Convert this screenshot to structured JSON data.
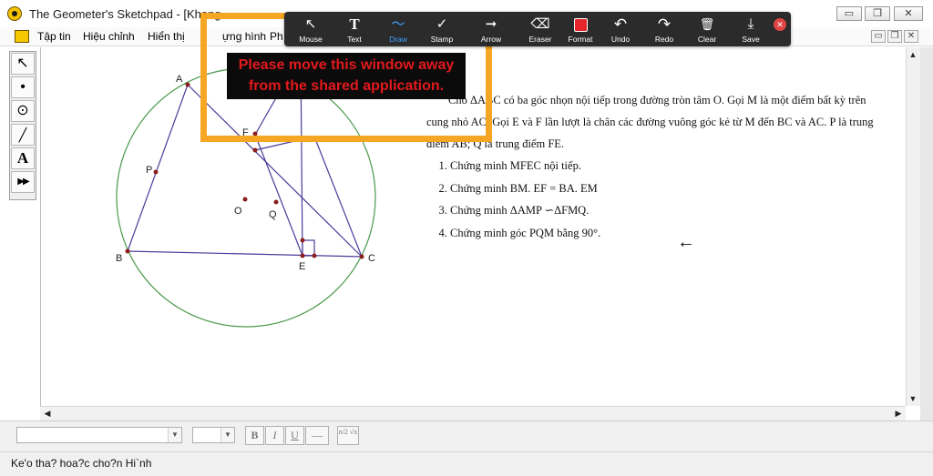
{
  "window": {
    "title": "The Geometer's Sketchpad - [Khong",
    "minimize": "▭",
    "restore": "❐",
    "close": "✕"
  },
  "menu": {
    "items": [
      "Tập tin",
      "Hiệu chỉnh",
      "Hiển thị",
      "ựng hình",
      "Ph"
    ],
    "mdi_minimize": "▭",
    "mdi_restore": "❐",
    "mdi_close": "✕"
  },
  "toolbox": {
    "tools": [
      {
        "name": "arrow-select-tool",
        "glyph": "↖"
      },
      {
        "name": "point-tool",
        "glyph": "•"
      },
      {
        "name": "compass-tool",
        "glyph": "⊙"
      },
      {
        "name": "straightedge-tool",
        "glyph": "╱"
      },
      {
        "name": "text-tool",
        "glyph": "A"
      },
      {
        "name": "custom-tool",
        "glyph": "▶▶"
      }
    ]
  },
  "figure": {
    "labels": {
      "A": "A",
      "B": "B",
      "C": "C",
      "E": "E",
      "F": "F",
      "P": "P",
      "O": "O",
      "Q": "Q"
    },
    "colors": {
      "circle": "#4a9a4a",
      "segment": "#4b3b99",
      "point": "#8a1f1f"
    }
  },
  "problem": {
    "intro": "Cho ΔABC có ba góc nhọn nội tiếp trong đường tròn tâm O. Gọi M là một điểm bất kỳ trên cung nhỏ AC. Gọi E và F lần lượt là chân các đường vuông góc kẻ từ M đến BC và AC. P là trung điểm AB; Q là trung điểm FE.",
    "items": [
      "Chứng minh MFEC nội tiếp.",
      "Chứng minh BM. EF = BA. EM",
      "Chứng minh  ΔAMP ∽ΔFMQ.",
      "Chứng minh  góc PQM bằng 90°."
    ]
  },
  "formatbar": {
    "font_value": "",
    "size_value": "",
    "bold": "B",
    "italic": "I",
    "underline": "U",
    "color": "—",
    "math": "n/2 √x"
  },
  "status": {
    "text": "Ke'o tha? hoa?c cho?n Hi`nh"
  },
  "share": {
    "message_line1": "Please move this window away",
    "message_line2": "from the shared application.",
    "frame_color": "#f5a623"
  },
  "annotation_toolbar": {
    "buttons": [
      {
        "name": "mouse",
        "label": "Mouse",
        "glyph": "↖"
      },
      {
        "name": "text",
        "label": "Text",
        "glyph": "T"
      },
      {
        "name": "draw",
        "label": "Draw",
        "glyph": "〜"
      },
      {
        "name": "stamp",
        "label": "Stamp",
        "glyph": "✓"
      },
      {
        "name": "arrow",
        "label": "Arrow",
        "glyph": "➞"
      },
      {
        "name": "eraser",
        "label": "Eraser",
        "glyph": "⌫"
      },
      {
        "name": "format",
        "label": "Format",
        "glyph": ""
      },
      {
        "name": "undo",
        "label": "Undo",
        "glyph": "↶"
      },
      {
        "name": "redo",
        "label": "Redo",
        "glyph": "↷"
      },
      {
        "name": "clear",
        "label": "Clear",
        "glyph": "🗑"
      },
      {
        "name": "save",
        "label": "Save",
        "glyph": "⤓"
      }
    ],
    "active": "draw",
    "active_color": "#3ea0ff",
    "format_color": "#e5252a",
    "close_glyph": "✕"
  },
  "cursor_glyph": "←"
}
